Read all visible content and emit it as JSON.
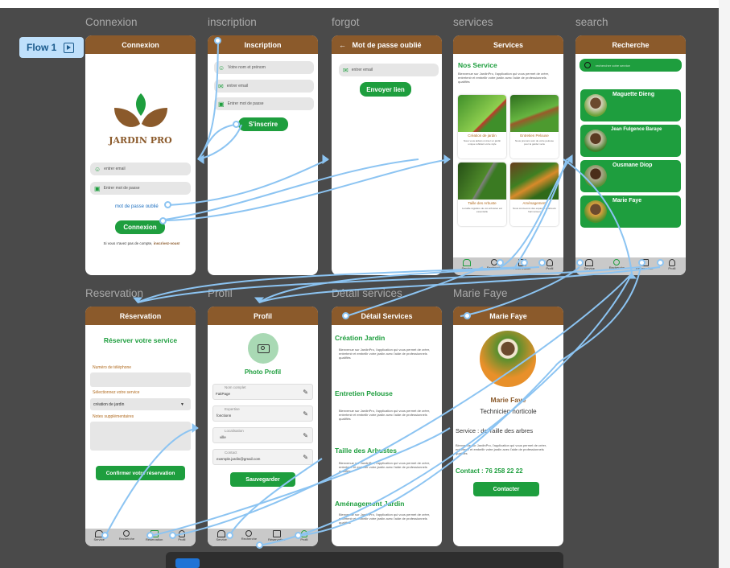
{
  "flow": {
    "label": "Flow 1"
  },
  "frames": {
    "connexion": "Connexion",
    "inscription": "inscription",
    "forgot": "forgot",
    "services": "services",
    "search": "search",
    "reservation": "Reservation",
    "profil": "Profil",
    "detail": "Détail services",
    "mariefaye": "Marie Faye"
  },
  "login": {
    "header": "Connexion",
    "logo_text": "JARDIN PRO",
    "email_placeholder": "entrer email",
    "password_placeholder": "Entrer mot de passe",
    "forgot_link": "mot de passe oublié",
    "login_button": "Connexion",
    "no_account": "Si vous n'avez pas de compte,",
    "signup_link": "inscrivez-vous!"
  },
  "signup": {
    "header": "Inscription",
    "name_placeholder": "Votre nom et prénom",
    "email_placeholder": "entrer email",
    "password_placeholder": "Entrer mot de passe",
    "button": "S'inscrire"
  },
  "forgot": {
    "header": "Mot de passe oublié",
    "email_placeholder": "entrer email",
    "button": "Envoyer lien"
  },
  "services": {
    "header": "Services",
    "title": "Nos Service",
    "intro": "Bienvenue sur JardinPro, l'application qui vous permet de créer, entretenir et embellir votre jardin avec l'aide de professionnels qualifiés",
    "cards": [
      {
        "title": "Création de jardin",
        "desc": "Nous vous aidons à créer un jardin unique reflétant votre style"
      },
      {
        "title": "Entretien Pelouse",
        "desc": "Nous prenons soin de votre pelouse pour la garder verte"
      },
      {
        "title": "Taille des Arbuste",
        "desc": "La taille régulière de vos arbustes est essentielle"
      },
      {
        "title": "Aménagement",
        "desc": "Nous concevons des espaces extérieurs harmonieux"
      }
    ]
  },
  "search": {
    "header": "Recherche",
    "placeholder": "rechercher votre service",
    "pros": [
      {
        "name": "Maguette Dieng"
      },
      {
        "name": "Jean Fulgence Baraye"
      },
      {
        "name": "Ousmane Diop"
      },
      {
        "name": "Marie Faye"
      }
    ]
  },
  "tabs": {
    "service": "Service",
    "recherche": "Recherche",
    "reservation": "Réservation",
    "profil": "Profil"
  },
  "reservation": {
    "header": "Réservation",
    "title": "Réserver votre service",
    "phone_label": "Numéro de téléphone",
    "select_label": "Sélectionnez votre service",
    "select_value": "création de jardin",
    "notes_label": "Notes supplémentaires",
    "button": "Confirmer votre réservation"
  },
  "profil": {
    "header": "Profil",
    "photo_label": "Photo Profil",
    "fields": [
      {
        "label": "Nom complet",
        "value": "FaitPage"
      },
      {
        "label": "Expertise",
        "value": "fonctionn"
      },
      {
        "label": "Localisation",
        "value": "ville"
      },
      {
        "label": "Contact",
        "value": "exemple.jardin@gmail.com"
      }
    ],
    "button": "Sauvegarder"
  },
  "detail": {
    "header": "Détail Services",
    "body": "Bienvenue sur JardinPro, l'application qui vous permet de créer, entretenir et embellir votre jardin avec l'aide de professionnels qualifiés",
    "sections": [
      "Création Jardin",
      "Entretien Pelouse",
      "Taille des Arbustes",
      "Aménagement Jardin"
    ]
  },
  "marie": {
    "header": "Marie Faye",
    "name": "Marie Faye",
    "role": "Technicien horticole",
    "service": "Service : de Taille des arbres",
    "body": "Bienvenue sur JardinPro, l'application qui vous permet de créer, entretenir et embellir votre jardin avec l'aide de professionnels qualifiés",
    "contact": "Contact : 76 258 22 22",
    "button": "Contacter"
  },
  "colors": {
    "brown": "#8b5a2b",
    "green": "#1e9e3e",
    "wire": "#8cc4f2"
  }
}
